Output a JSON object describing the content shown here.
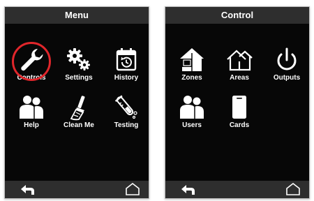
{
  "colors": {
    "background": "#ffffff",
    "bar": "#2e2e2e",
    "body": "#070707",
    "text": "#ffffff",
    "highlight": "#e1262b"
  },
  "menu_screen": {
    "title": "Menu",
    "items": [
      {
        "label": "Controls",
        "icon": "wrench-icon",
        "highlighted": true
      },
      {
        "label": "Settings",
        "icon": "gears-icon"
      },
      {
        "label": "History",
        "icon": "calendar-history-icon"
      },
      {
        "label": "Help",
        "icon": "people-icon"
      },
      {
        "label": "Clean Me",
        "icon": "brush-icon"
      },
      {
        "label": "Testing",
        "icon": "test-tube-icon"
      }
    ],
    "footer": {
      "back_icon": "back-arrow-icon",
      "home_icon": "home-icon"
    }
  },
  "control_screen": {
    "title": "Control",
    "items": [
      {
        "label": "Zones",
        "icon": "house-zones-icon"
      },
      {
        "label": "Areas",
        "icon": "houses-areas-icon"
      },
      {
        "label": "Outputs",
        "icon": "power-icon"
      },
      {
        "label": "Users",
        "icon": "people-icon"
      },
      {
        "label": "Cards",
        "icon": "card-icon"
      }
    ],
    "footer": {
      "back_icon": "back-arrow-icon",
      "home_icon": "home-icon"
    }
  }
}
